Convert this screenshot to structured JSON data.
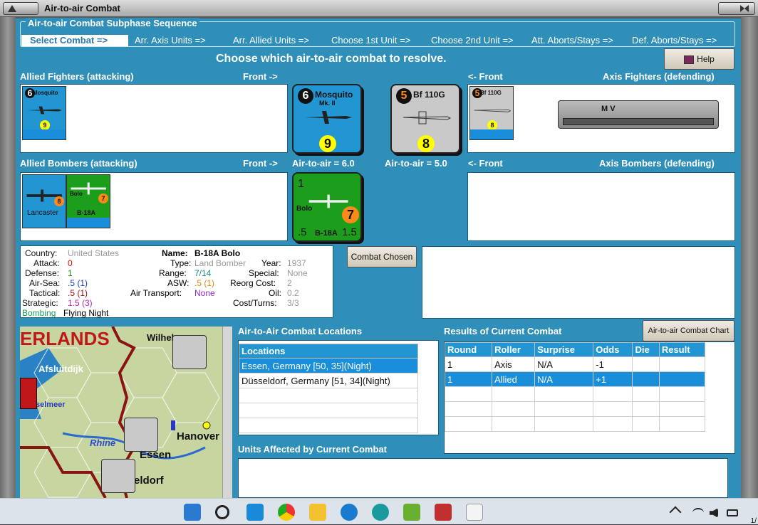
{
  "window": {
    "title": "Air-to-air Combat"
  },
  "sequence": {
    "title": "Air-to-air Combat Subphase Sequence",
    "steps": [
      "Select Combat =>",
      "Arr. Axis Units =>",
      "Arr. Allied Units =>",
      "Choose 1st Unit =>",
      "Choose 2nd Unit =>",
      "Att. Aborts/Stays =>",
      "Def. Aborts/Stays =>"
    ]
  },
  "prompt": "Choose which air-to-air combat to resolve.",
  "help_label": "Help",
  "labels": {
    "allied_fighters": "Allied Fighters (attacking)",
    "front_right": "Front ->",
    "front_left": "<- Front",
    "axis_fighters": "Axis Fighters (defending)",
    "allied_bombers": "Allied Bombers (attacking)",
    "axis_bombers": "Axis Bombers (defending)",
    "air_to_air_allied": "Air-to-air = 6.0",
    "air_to_air_axis": "Air-to-air = 5.0"
  },
  "counters": {
    "mosquito": {
      "attack": "6",
      "name": "Mosquito",
      "mark": "Mk. II",
      "defense": "9"
    },
    "bf110": {
      "attack": "5",
      "name": "Bf 110G",
      "defense": "8"
    },
    "lancaster": {
      "name": "Lancaster",
      "defense": "8"
    },
    "bolo": {
      "name": "Bolo",
      "model": "B-18A",
      "attack": "1",
      "defense": "7",
      "val": ".5",
      "val2": "1.5"
    }
  },
  "mini_window": {
    "title": "M V"
  },
  "combat_chosen_label": "Combat Chosen",
  "unit_info": {
    "country_k": "Country:",
    "country_v": "United States",
    "attack_k": "Attack:",
    "attack_v": "0",
    "defense_k": "Defense:",
    "defense_v": "1",
    "airsea_k": "Air-Sea:",
    "airsea_v": ".5 (1)",
    "tactical_k": "Tactical:",
    "tactical_v": ".5 (1)",
    "strategic_k": "Strategic:",
    "strategic_v": "1.5 (3)",
    "bombing_k": "Bombing",
    "bombing_v": "Flying Night",
    "name_k": "Name:",
    "name_v": "B-18A Bolo",
    "type_k": "Type:",
    "type_v": "Land Bomber",
    "range_k": "Range:",
    "range_v": "7/14",
    "asw_k": "ASW:",
    "asw_v": ".5 (1)",
    "airtransport_k": "Air Transport:",
    "airtransport_v": "None",
    "year_k": "Year:",
    "year_v": "1937",
    "special_k": "Special:",
    "special_v": "None",
    "reorg_k": "Reorg Cost:",
    "reorg_v": "2",
    "oil_k": "Oil:",
    "oil_v": "0.2",
    "costturns_k": "Cost/Turns:",
    "costturns_v": "3/3"
  },
  "locations": {
    "heading": "Air-to-Air Combat Locations",
    "column": "Locations",
    "rows": [
      "Essen, Germany [50, 35](Night)",
      "Düsseldorf, Germany [51, 34](Night)"
    ]
  },
  "results": {
    "heading": "Results of Current Combat",
    "chart_button": "Air-to-air Combat Chart",
    "columns": [
      "Round",
      "Roller",
      "Surprise",
      "Odds",
      "Die",
      "Result"
    ],
    "rows": [
      [
        "1",
        "Axis",
        "N/A",
        "-1",
        "",
        ""
      ],
      [
        "1",
        "Allied",
        "N/A",
        "+1",
        "",
        ""
      ]
    ]
  },
  "units_affected_heading": "Units Affected by Current Combat",
  "map": {
    "labels": [
      "ERLANDS",
      "Afsluitdijk",
      "selmeer",
      "Rhine",
      "Essen",
      "eldorf",
      "Hanover",
      "Wilhel"
    ]
  },
  "taskbar": {
    "clock": "1/"
  },
  "colors": {
    "panel": "#2f8fb8",
    "selection": "#1a8ed8",
    "allied_blue": "#2196d3",
    "us_green": "#1c9e1c"
  }
}
